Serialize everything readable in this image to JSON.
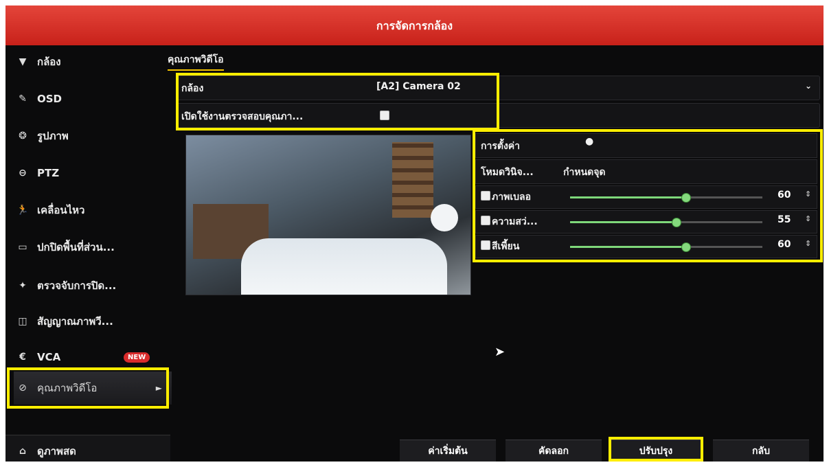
{
  "window": {
    "title": "การจัดการกล้อง"
  },
  "sidebar": {
    "items": [
      {
        "icon": "camera-icon",
        "label": "กล้อง"
      },
      {
        "icon": "osd-icon",
        "label": "OSD"
      },
      {
        "icon": "image-icon",
        "label": "รูปภาพ"
      },
      {
        "icon": "ptz-icon",
        "label": "PTZ"
      },
      {
        "icon": "motion-icon",
        "label": "เคลื่อนไหว"
      },
      {
        "icon": "privacy-mask-icon",
        "label": "ปกปิดพื้นที่ส่วน..."
      },
      {
        "icon": "tamper-icon",
        "label": "ตรวจจับการปิด..."
      },
      {
        "icon": "video-loss-icon",
        "label": "สัญญาณภาพวี..."
      },
      {
        "icon": "vca-icon",
        "label": "VCA",
        "badge": "NEW"
      },
      {
        "icon": "video-quality-icon",
        "label": "คุณภาพวิดีโอ"
      }
    ],
    "live_view": "ดูภาพสด"
  },
  "main": {
    "tab": "คุณภาพวิดีโอ",
    "camera_label": "กล้อง",
    "camera_value": "[A2] Camera 02",
    "enable_label": "เปิดใช้งานตรวจสอบคุณภา...",
    "settings": {
      "config_label": "การตั้งค่า",
      "mode_label": "โหมดวินิจ...",
      "mode_value": "กำหนดจุด",
      "rows": [
        {
          "label": "ภาพเบลอ",
          "value": "60",
          "level": 0.6
        },
        {
          "label": "ความสว่...",
          "value": "55",
          "level": 0.55
        },
        {
          "label": "สีเพี้ยน",
          "value": "60",
          "level": 0.6
        }
      ]
    }
  },
  "buttons": {
    "default": "ค่าเริ่มต้น",
    "copy": "คัดลอก",
    "apply": "ปรับปรุง",
    "back": "กลับ"
  },
  "colors": {
    "title_bar": "#d82a20",
    "highlight": "#ffee00",
    "slider": "#7ed87a",
    "tab_underline": "#f5c400"
  }
}
